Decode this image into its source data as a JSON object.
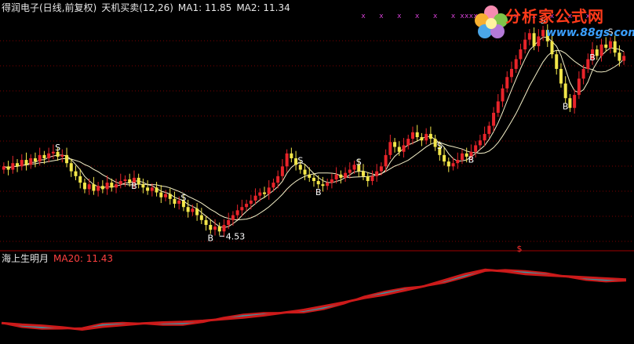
{
  "header": {
    "stock_name": "得润电子(日线,前复权)",
    "indicator": "天机买卖(12,26)",
    "ma1_label": "MA1: 11.85",
    "ma2_label": "MA2: 11.34"
  },
  "lower_panel": {
    "indicator": "海上生明月",
    "ma20_label": "MA20: 11.43"
  },
  "logo": {
    "title": "分析家公式网",
    "url": "www.88gs.com"
  },
  "colors": {
    "up": "#e8242a",
    "down": "#f2e64a",
    "ma1": "#f5f0c8",
    "ma2": "#f5f0c8",
    "signal": "#ffffff",
    "x_mark": "#d040d0",
    "lower_red": "#cc1a1a",
    "lower_cyan": "#38b8c8",
    "grid": "#7a0000",
    "header_white": "#e8e8e8",
    "header_yellow": "#f0e000",
    "header_red": "#ff4040"
  },
  "chart_data": {
    "type": "candlestick",
    "min_label": "4.53",
    "price_range": [
      4.0,
      17.5
    ],
    "closes": [
      8.9,
      8.7,
      9.1,
      8.9,
      9.3,
      9.0,
      9.4,
      9.2,
      9.6,
      9.4,
      9.7,
      9.8,
      9.5,
      9.6,
      9.1,
      8.6,
      8.3,
      7.9,
      7.5,
      7.8,
      7.4,
      7.7,
      7.5,
      7.9,
      7.6,
      7.8,
      8.0,
      8.1,
      7.9,
      8.2,
      7.8,
      7.6,
      7.4,
      7.6,
      7.3,
      7.0,
      7.2,
      6.9,
      6.6,
      6.8,
      6.4,
      6.1,
      6.3,
      5.9,
      5.6,
      5.3,
      5.0,
      5.2,
      4.9,
      5.3,
      5.6,
      5.9,
      6.2,
      6.4,
      6.6,
      6.8,
      7.1,
      7.3,
      7.2,
      7.6,
      7.9,
      8.3,
      8.9,
      9.7,
      9.4,
      9.0,
      8.7,
      8.4,
      8.2,
      8.0,
      7.8,
      7.7,
      7.9,
      8.1,
      8.4,
      8.2,
      8.5,
      8.7,
      9.0,
      8.6,
      8.3,
      8.0,
      8.3,
      8.6,
      8.9,
      9.6,
      10.4,
      10.1,
      9.8,
      10.2,
      10.6,
      11.0,
      10.7,
      10.5,
      10.9,
      10.6,
      10.1,
      9.6,
      9.2,
      8.9,
      9.1,
      9.3,
      9.7,
      9.5,
      9.8,
      10.2,
      10.5,
      10.9,
      11.4,
      12.2,
      12.9,
      13.7,
      14.4,
      14.9,
      15.5,
      16.1,
      16.7,
      17.1,
      16.3,
      16.9,
      17.3,
      16.6,
      15.8,
      14.9,
      14.0,
      13.1,
      12.5,
      13.3,
      14.3,
      14.9,
      15.5,
      16.1,
      15.7,
      16.4,
      16.2,
      16.6,
      15.9,
      15.4,
      15.7
    ],
    "signals": [
      {
        "type": "S",
        "index": 12
      },
      {
        "type": "B",
        "index": 29
      },
      {
        "type": "S",
        "index": 40
      },
      {
        "type": "B",
        "index": 46
      },
      {
        "type": "S",
        "index": 66
      },
      {
        "type": "B",
        "index": 70
      },
      {
        "type": "S",
        "index": 79
      },
      {
        "type": "S",
        "index": 97
      },
      {
        "type": "B",
        "index": 104
      },
      {
        "type": "S",
        "index": 120
      },
      {
        "type": "B",
        "index": 125
      },
      {
        "type": "B",
        "index": 131
      },
      {
        "type": "S",
        "index": 135
      }
    ],
    "x_marks": [
      80,
      84,
      88,
      92,
      96,
      100,
      102,
      103,
      104,
      105,
      106,
      107,
      108,
      110,
      114,
      118,
      122,
      126,
      130
    ],
    "lower_series": {
      "values": [
        -0.5,
        -0.8,
        -1.0,
        -1.3,
        -1.7,
        -1.2,
        -0.9,
        -0.6,
        -0.4,
        -0.3,
        -0.1,
        0.2,
        0.5,
        0.9,
        1.4,
        1.9,
        2.6,
        3.3,
        4.1,
        4.7,
        5.5,
        6.3,
        7.4,
        8.5,
        9.3,
        9.0,
        8.5,
        8.3,
        8.1,
        7.9,
        7.7,
        7.5
      ]
    }
  }
}
